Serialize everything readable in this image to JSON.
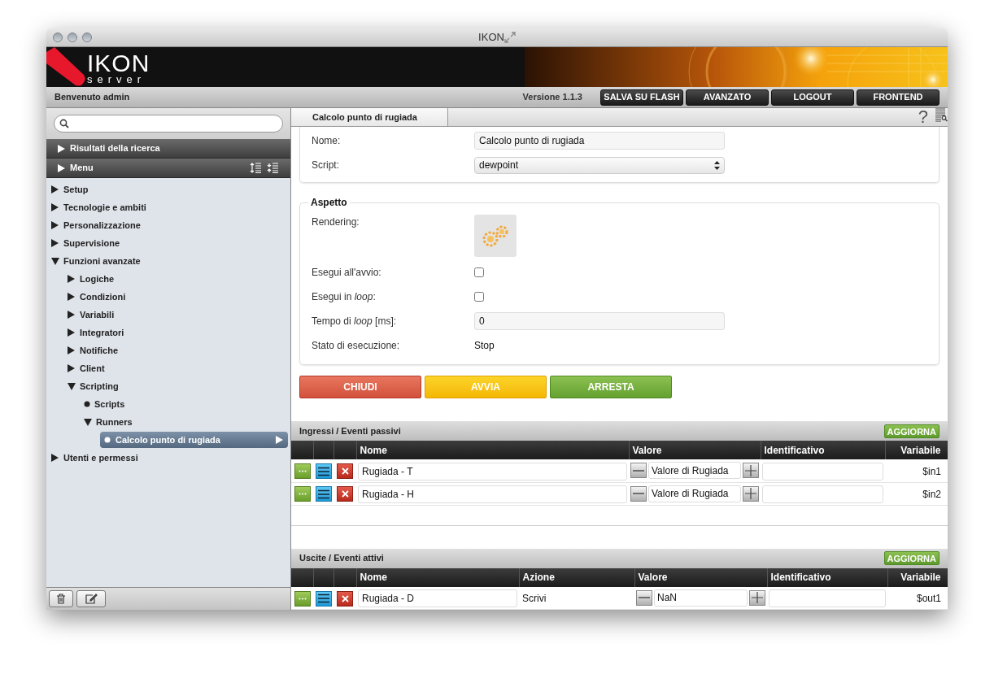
{
  "window": {
    "title": "IKON"
  },
  "logo": {
    "name": "IKON",
    "sub": "server"
  },
  "toolbar": {
    "welcome": "Benvenuto admin",
    "version": "Versione 1.1.3",
    "buttons": [
      "SALVA SU FLASH",
      "AVANZATO",
      "LOGOUT",
      "FRONTEND"
    ]
  },
  "sidebar": {
    "sections": [
      {
        "label": "Risultati della ricerca"
      },
      {
        "label": "Menu"
      }
    ],
    "tree": [
      {
        "label": "Setup",
        "kind": "folder",
        "expanded": false,
        "selected": false
      },
      {
        "label": "Tecnologie e ambiti",
        "kind": "folder",
        "expanded": false,
        "selected": false
      },
      {
        "label": "Personalizzazione",
        "kind": "folder",
        "expanded": false,
        "selected": false
      },
      {
        "label": "Supervisione",
        "kind": "folder",
        "expanded": false,
        "selected": false
      },
      {
        "label": "Funzioni avanzate",
        "kind": "folder",
        "expanded": true,
        "selected": false,
        "children": [
          {
            "label": "Logiche",
            "kind": "folder",
            "expanded": false,
            "selected": false
          },
          {
            "label": "Condizioni",
            "kind": "folder",
            "expanded": false,
            "selected": false
          },
          {
            "label": "Variabili",
            "kind": "folder",
            "expanded": false,
            "selected": false
          },
          {
            "label": "Integratori",
            "kind": "folder",
            "expanded": false,
            "selected": false
          },
          {
            "label": "Notifiche",
            "kind": "folder",
            "expanded": false,
            "selected": false
          },
          {
            "label": "Client",
            "kind": "folder",
            "expanded": false,
            "selected": false
          },
          {
            "label": "Scripting",
            "kind": "folder",
            "expanded": true,
            "selected": false,
            "children": [
              {
                "label": "Scripts",
                "kind": "leaf",
                "selected": false
              },
              {
                "label": "Runners",
                "kind": "folder",
                "expanded": true,
                "selected": false,
                "children": [
                  {
                    "label": "Calcolo punto di rugiada",
                    "kind": "leaf",
                    "selected": true
                  }
                ]
              }
            ]
          }
        ]
      },
      {
        "label": "Utenti e permessi",
        "kind": "folder",
        "expanded": false,
        "selected": false
      }
    ]
  },
  "tabs": [
    {
      "label": "Calcolo punto di rugiada",
      "selected": true
    }
  ],
  "help_glyph": "?",
  "general": {
    "fields": [
      {
        "label": "Nome:",
        "kind": "text",
        "value": "Calcolo punto di rugiada"
      },
      {
        "label": "Script:",
        "kind": "select",
        "value": "dewpoint"
      }
    ]
  },
  "aspetto": {
    "title": "Aspetto",
    "fields": [
      {
        "label": "Rendering:",
        "kind": "image"
      },
      {
        "label": "Esegui all'avvio:",
        "kind": "checkbox",
        "checked": false
      },
      {
        "label": "Esegui in *loop*:",
        "kind": "checkbox",
        "checked": false
      },
      {
        "label": "Tempo di *loop* [ms]:",
        "kind": "text",
        "value": "0"
      },
      {
        "label": "Stato di esecuzione:",
        "kind": "static",
        "value": "Stop"
      }
    ]
  },
  "actions": [
    {
      "label": "CHIUDI",
      "kind": "danger"
    },
    {
      "label": "AVVIA",
      "kind": "warning"
    },
    {
      "label": "ARRESTA",
      "kind": "success"
    }
  ],
  "inputs": {
    "title": "Ingressi / Eventi passivi",
    "refresh": "AGGIORNA",
    "columns": [
      "Nome",
      "Valore",
      "Identificativo",
      "Variabile"
    ],
    "rows": [
      {
        "nome": "Rugiada - T",
        "valore": "Valore di Rugiada",
        "variabile": "$in1"
      },
      {
        "nome": "Rugiada - H",
        "valore": "Valore di Rugiada",
        "variabile": "$in2"
      }
    ]
  },
  "outputs": {
    "title": "Uscite / Eventi attivi",
    "refresh": "AGGIORNA",
    "columns": [
      "Nome",
      "Azione",
      "Valore",
      "Identificativo",
      "Variabile"
    ],
    "rows": [
      {
        "nome": "Rugiada - D",
        "azione": "Scrivi",
        "valore": "NaN",
        "variabile": "$out1"
      }
    ]
  }
}
